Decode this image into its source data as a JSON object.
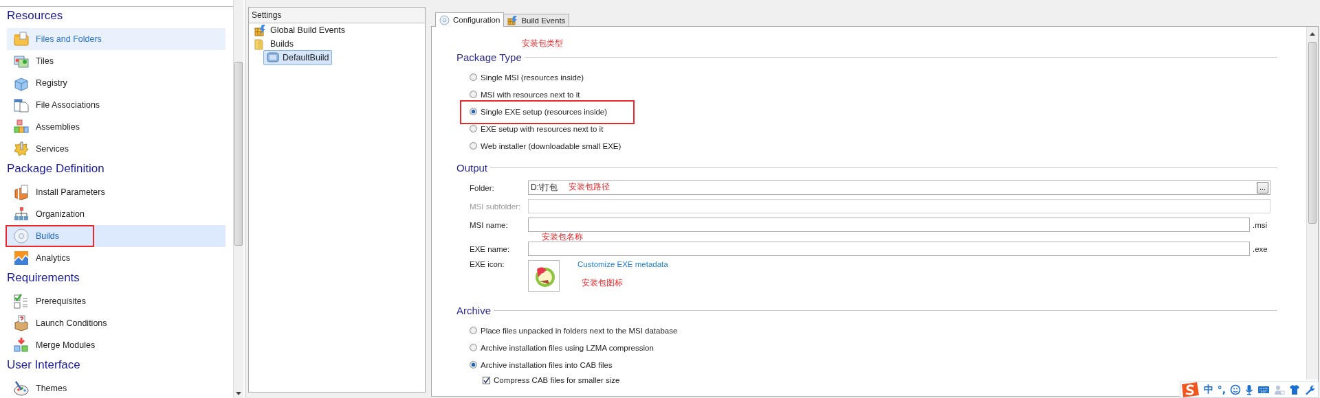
{
  "sidebar": {
    "sections": [
      {
        "title": "Resources",
        "items": [
          {
            "label": "Files and Folders",
            "selected": false,
            "hovered": true,
            "highlighted": false
          },
          {
            "label": "Tiles",
            "selected": false,
            "hovered": false,
            "highlighted": false
          },
          {
            "label": "Registry",
            "selected": false,
            "hovered": false,
            "highlighted": false
          },
          {
            "label": "File Associations",
            "selected": false,
            "hovered": false,
            "highlighted": false
          },
          {
            "label": "Assemblies",
            "selected": false,
            "hovered": false,
            "highlighted": false
          },
          {
            "label": "Services",
            "selected": false,
            "hovered": false,
            "highlighted": false
          }
        ]
      },
      {
        "title": "Package Definition",
        "items": [
          {
            "label": "Install Parameters",
            "selected": false,
            "hovered": false,
            "highlighted": false
          },
          {
            "label": "Organization",
            "selected": false,
            "hovered": false,
            "highlighted": false
          },
          {
            "label": "Builds",
            "selected": true,
            "hovered": false,
            "highlighted": true
          },
          {
            "label": "Analytics",
            "selected": false,
            "hovered": false,
            "highlighted": false
          }
        ]
      },
      {
        "title": "Requirements",
        "items": [
          {
            "label": "Prerequisites",
            "selected": false,
            "hovered": false,
            "highlighted": false
          },
          {
            "label": "Launch Conditions",
            "selected": false,
            "hovered": false,
            "highlighted": false
          },
          {
            "label": "Merge Modules",
            "selected": false,
            "hovered": false,
            "highlighted": false
          }
        ]
      },
      {
        "title": "User Interface",
        "items": [
          {
            "label": "Themes",
            "selected": false,
            "hovered": false,
            "highlighted": false
          }
        ]
      }
    ]
  },
  "tree": {
    "header": "Settings",
    "items": [
      {
        "label": "Global Build Events",
        "selected": false
      },
      {
        "label": "Builds",
        "selected": false,
        "children": [
          {
            "label": "DefaultBuild",
            "selected": true
          }
        ]
      }
    ]
  },
  "tabs": [
    {
      "label": "Configuration",
      "selected": true
    },
    {
      "label": "Build Events",
      "selected": false
    }
  ],
  "sections": [
    {
      "heading": "Package Type",
      "annotation": "安装包类型",
      "kind": "options",
      "options": [
        {
          "kind": "radio",
          "label": "Single MSI (resources inside)",
          "selected": false,
          "highlighted": false
        },
        {
          "kind": "radio",
          "label": "MSI with resources next to it",
          "selected": false,
          "highlighted": false
        },
        {
          "kind": "radio",
          "label": "Single EXE setup (resources inside)",
          "selected": true,
          "highlighted": true
        },
        {
          "kind": "radio",
          "label": "EXE setup with resources next to it",
          "selected": false,
          "highlighted": false
        },
        {
          "kind": "radio",
          "label": "Web installer (downloadable small EXE)",
          "selected": false,
          "highlighted": false
        }
      ]
    },
    {
      "heading": "Output",
      "kind": "fields",
      "fields": [
        {
          "kind": "browse",
          "label": "Folder:",
          "value": "D:\\打包",
          "disabled": false,
          "button": "...",
          "annotation": "安装包路径"
        },
        {
          "kind": "text",
          "label": "MSI subfolder:",
          "disabled": true
        },
        {
          "kind": "text",
          "label": "MSI name:",
          "disabled": false,
          "suffix": ".msi",
          "annotation": "安装包名称"
        },
        {
          "kind": "text",
          "label": "EXE name:",
          "disabled": false,
          "suffix": ".exe"
        },
        {
          "kind": "icon",
          "label": "EXE icon:",
          "link": "Customize EXE metadata",
          "annotation": "安装包图标"
        }
      ]
    },
    {
      "heading": "Archive",
      "kind": "options",
      "options": [
        {
          "kind": "radio",
          "label": "Place files unpacked in folders next to the MSI database",
          "selected": false,
          "highlighted": false
        },
        {
          "kind": "radio",
          "label": "Archive installation files using LZMA compression",
          "selected": false,
          "highlighted": false
        },
        {
          "kind": "radio",
          "label": "Archive installation files into CAB files",
          "selected": true,
          "highlighted": false
        },
        {
          "kind": "checkbox",
          "label": "Compress CAB files for smaller size",
          "checked": true
        }
      ]
    }
  ],
  "ime_bar": {
    "mode": "中",
    "punctuation": "°,"
  }
}
